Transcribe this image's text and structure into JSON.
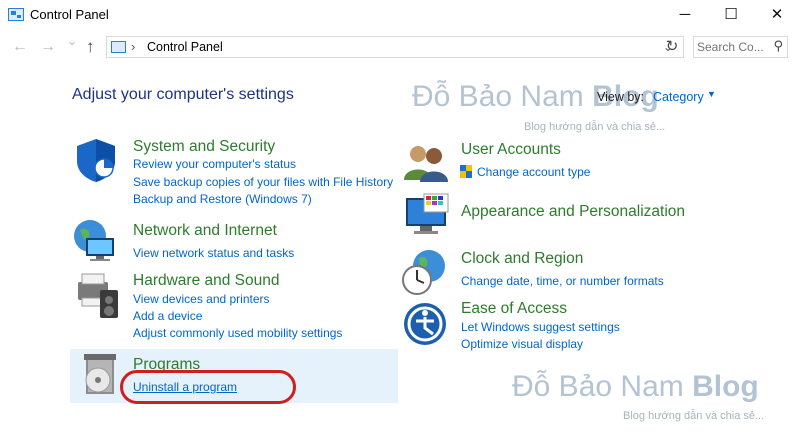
{
  "window": {
    "title": "Control Panel",
    "minimize": "─",
    "maximize": "☐",
    "close": "✕"
  },
  "nav": {
    "back": "←",
    "forward": "→",
    "recent": "⌄",
    "up": "↑"
  },
  "address": {
    "separator": "›",
    "location": "Control Panel",
    "dropdown": "⌄",
    "refresh": "↻"
  },
  "search": {
    "placeholder": "Search Co...",
    "icon": "⚲"
  },
  "page": {
    "heading": "Adjust your computer's settings",
    "view_by_label": "View by:",
    "view_by_value": "Category"
  },
  "categories": {
    "system_security": {
      "title": "System and Security",
      "links": [
        "Review your computer's status",
        "Save backup copies of your files with File History",
        "Backup and Restore (Windows 7)"
      ]
    },
    "network_internet": {
      "title": "Network and Internet",
      "links": [
        "View network status and tasks"
      ]
    },
    "hardware_sound": {
      "title": "Hardware and Sound",
      "links": [
        "View devices and printers",
        "Add a device",
        "Adjust commonly used mobility settings"
      ]
    },
    "programs": {
      "title": "Programs",
      "links": [
        "Uninstall a program"
      ]
    },
    "user_accounts": {
      "title": "User Accounts",
      "links": [
        "Change account type"
      ]
    },
    "appearance": {
      "title": "Appearance and Personalization",
      "links": []
    },
    "clock_region": {
      "title": "Clock and Region",
      "links": [
        "Change date, time, or number formats"
      ]
    },
    "ease_access": {
      "title": "Ease of Access",
      "links": [
        "Let Windows suggest settings",
        "Optimize visual display"
      ]
    }
  },
  "watermark": {
    "name": "Đỗ Bảo Nam",
    "blog": "Blog",
    "tagline": "Blog hướng dẫn và chia sẻ..."
  },
  "colors": {
    "accent_link": "#0066cc",
    "category_title": "#2c7c2c",
    "heading": "#1e3287",
    "highlight": "#e5f1fb",
    "annotation": "#d21d1d"
  }
}
